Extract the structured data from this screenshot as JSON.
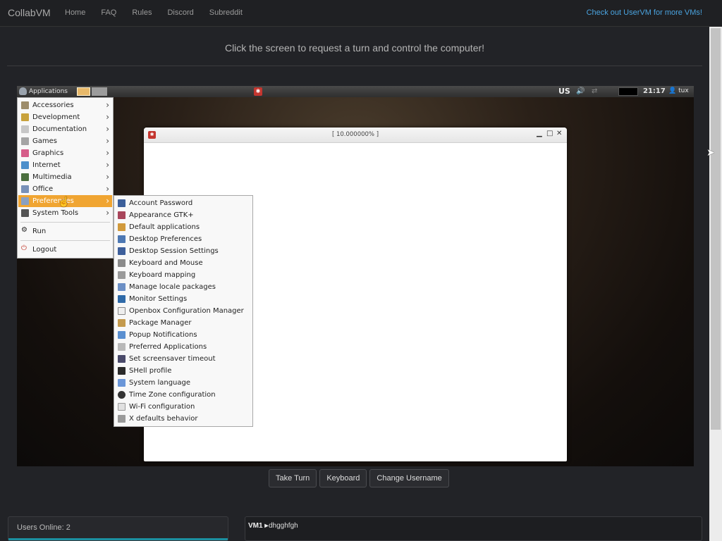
{
  "navbar": {
    "brand": "CollabVM",
    "links": [
      "Home",
      "FAQ",
      "Rules",
      "Discord",
      "Subreddit"
    ],
    "promo": "Check out UserVM for more VMs!"
  },
  "headline": "Click the screen to request a turn and control the computer!",
  "vm": {
    "panel": {
      "apps_label": "Applications",
      "keyboard_layout": "US",
      "clock": "21:17",
      "user": "tux"
    },
    "window": {
      "title": "[ 10.000000% ]"
    },
    "main_menu": [
      {
        "label": "Accessories",
        "icon_color": "#9d8c6a"
      },
      {
        "label": "Development",
        "icon_color": "#c8a23c"
      },
      {
        "label": "Documentation",
        "icon_color": "#c7c7c7"
      },
      {
        "label": "Games",
        "icon_color": "#a4a4a4"
      },
      {
        "label": "Graphics",
        "icon_color": "#d65d8a"
      },
      {
        "label": "Internet",
        "icon_color": "#4d8fcb"
      },
      {
        "label": "Multimedia",
        "icon_color": "#4b6f3e"
      },
      {
        "label": "Office",
        "icon_color": "#7891b8"
      },
      {
        "label": "Preferences",
        "icon_color": "#8aa0c0"
      },
      {
        "label": "System Tools",
        "icon_color": "#555555"
      }
    ],
    "run_label": "Run",
    "logout_label": "Logout",
    "preferences_menu": [
      {
        "label": "Account Password",
        "icon_color": "#3c5f9a"
      },
      {
        "label": "Appearance GTK+",
        "icon_color": "#a8455b"
      },
      {
        "label": "Default applications",
        "icon_color": "#d19a3c"
      },
      {
        "label": "Desktop Preferences",
        "icon_color": "#4d78b3"
      },
      {
        "label": "Desktop Session Settings",
        "icon_color": "#3d5f9b"
      },
      {
        "label": "Keyboard and Mouse",
        "icon_color": "#8a8a8a"
      },
      {
        "label": "Keyboard mapping",
        "icon_color": "#9a9a9a"
      },
      {
        "label": "Manage locale packages",
        "icon_color": "#6c8fc5"
      },
      {
        "label": "Monitor Settings",
        "icon_color": "#2f6aa8"
      },
      {
        "label": "Openbox Configuration Manager",
        "icon_color": "#eeeeee"
      },
      {
        "label": "Package Manager",
        "icon_color": "#c49a4d"
      },
      {
        "label": "Popup Notifications",
        "icon_color": "#5a8fd0"
      },
      {
        "label": "Preferred Applications",
        "icon_color": "#b8b8b8"
      },
      {
        "label": "Set screensaver timeout",
        "icon_color": "#4a4a6a"
      },
      {
        "label": "SHell profile",
        "icon_color": "#2a2a2a"
      },
      {
        "label": "System language",
        "icon_color": "#6a96d8"
      },
      {
        "label": "Time Zone configuration",
        "icon_color": "#333333"
      },
      {
        "label": "Wi-Fi configuration",
        "icon_color": "#e0e0e0"
      },
      {
        "label": "X defaults behavior",
        "icon_color": "#9a9a9a"
      }
    ]
  },
  "buttons": {
    "take_turn": "Take Turn",
    "keyboard": "Keyboard",
    "change_username": "Change Username"
  },
  "users_online": "Users Online: 2",
  "chat": {
    "sender": "VM1",
    "message": "dhgghfgh"
  }
}
